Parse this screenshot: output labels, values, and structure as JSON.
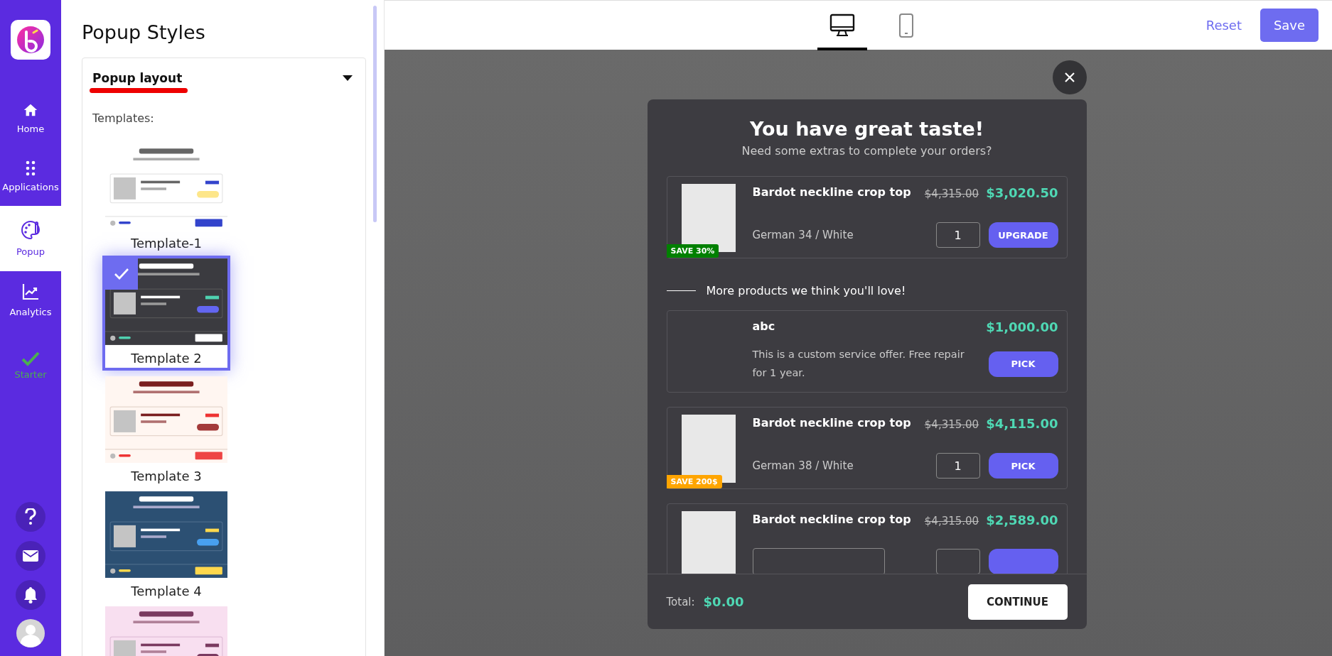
{
  "nav": {
    "items": [
      {
        "kind": "home",
        "label": "Home",
        "selected": false
      },
      {
        "kind": "apps",
        "label": "Applications",
        "selected": false
      },
      {
        "kind": "popup",
        "label": "Popup",
        "selected": true
      },
      {
        "kind": "analytics",
        "label": "Analytics",
        "selected": false
      }
    ],
    "plan": {
      "label": "Starter"
    },
    "bottom_icons": [
      {
        "kind": "help"
      },
      {
        "kind": "mail"
      },
      {
        "kind": "bell"
      },
      {
        "kind": "avatar"
      }
    ]
  },
  "panel": {
    "title": "Popup Styles",
    "section": {
      "title": "Popup layout",
      "expanded": true,
      "subtitle": "Templates:",
      "templates": [
        {
          "kind": "light",
          "label": "Template-1",
          "selected": false
        },
        {
          "kind": "dark",
          "label": "Template 2",
          "selected": true
        },
        {
          "kind": "cream",
          "label": "Template 3",
          "selected": false
        },
        {
          "kind": "navy",
          "label": "Template 4",
          "selected": false
        },
        {
          "kind": "pink",
          "selected": false
        }
      ]
    }
  },
  "toolbar": {
    "devices": [
      {
        "kind": "desktop",
        "selected": true
      },
      {
        "kind": "mobile",
        "selected": false
      }
    ],
    "reset": "Reset",
    "save": "Save"
  },
  "popup": {
    "title": "You have great taste!",
    "subtitle": "Need some extras to complete your orders?",
    "offers": [
      {
        "kind": "product",
        "name": "Bardot neckline crop top",
        "old_price": "$4,315.00",
        "price": "$3,020.50",
        "variant": "German 34 / White",
        "quantity": "1",
        "button": "UPGRADE",
        "badge": "SAVE 30%",
        "color": "#008000"
      }
    ],
    "more_heading": "More products we think you'll love!",
    "more": [
      {
        "kind": "service",
        "name": "abc",
        "price": "$1,000.00",
        "description": "This is a custom service offer. Free repair for 1 year.",
        "button": "PICK"
      },
      {
        "kind": "product",
        "name": "Bardot neckline crop top",
        "old_price": "$4,315.00",
        "price": "$4,115.00",
        "variant": "German 38 / White",
        "quantity": "1",
        "button": "PICK",
        "badge": "SAVE 200$",
        "color": "#ffa500"
      },
      {
        "kind": "product",
        "name": "Bardot neckline crop top",
        "old_price": "$4,315.00",
        "price": "$2,589.00"
      }
    ],
    "total_label": "Total:",
    "total": "$0.00",
    "continue": "CONTINUE"
  }
}
